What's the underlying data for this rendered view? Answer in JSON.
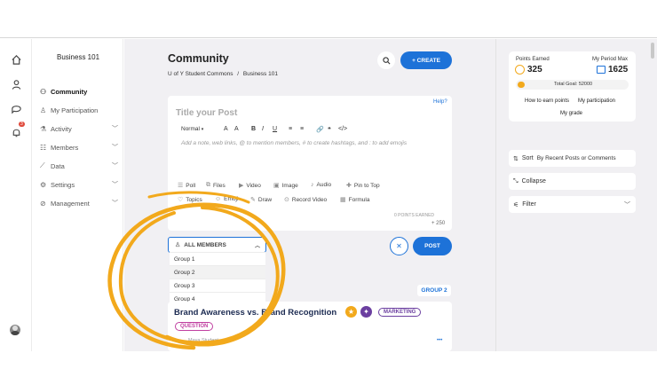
{
  "rail": {
    "icons": [
      "home-icon",
      "people-icon",
      "chat-icon",
      "bell-icon"
    ],
    "bell_count": "3"
  },
  "nav": {
    "title": "Business 101",
    "items": [
      {
        "label": "Community",
        "icon": "people-icon",
        "active": true,
        "chevron": false
      },
      {
        "label": "My Participation",
        "icon": "user-icon",
        "active": false,
        "chevron": false
      },
      {
        "label": "Activity",
        "icon": "activity-icon",
        "active": false,
        "chevron": true
      },
      {
        "label": "Members",
        "icon": "members-icon",
        "active": false,
        "chevron": true
      },
      {
        "label": "Data",
        "icon": "chart-icon",
        "active": false,
        "chevron": true
      },
      {
        "label": "Settings",
        "icon": "gear-icon",
        "active": false,
        "chevron": true
      },
      {
        "label": "Management",
        "icon": "compass-icon",
        "active": false,
        "chevron": true
      }
    ]
  },
  "header": {
    "title": "Community",
    "breadcrumb_1": "U of Y Student Commons",
    "breadcrumb_sep": "/",
    "breadcrumb_2": "Business 101",
    "create_label": "+ CREATE"
  },
  "composer": {
    "title_placeholder": "Title your Post",
    "help": "Help?",
    "format": "Normal",
    "toolbar": [
      "A",
      "A",
      "B",
      "I",
      "U",
      "≡",
      "≡",
      "🔗",
      "❝",
      "</>"
    ],
    "body_placeholder": "Add a note, web links, @ to mention members, # to create hashtags, and : to add emojis",
    "tools_row1": [
      "Poll",
      "Files",
      "Video",
      "Image",
      "Audio",
      "Pin to Top"
    ],
    "tools_row2": [
      "Topics",
      "Emoji",
      "Draw",
      "Record Video",
      "Formula"
    ],
    "points_earned": "0 POINTS EARNED",
    "points_plus": "+ 250"
  },
  "audience": {
    "selected": "ALL MEMBERS",
    "options": [
      "Group 1",
      "Group 2",
      "Group 3",
      "Group 4"
    ],
    "post_label": "POST",
    "cancel": "✕"
  },
  "post": {
    "group_tag": "GROUP 2",
    "title": "Brand Awareness vs. Brand Recognition",
    "category": "MARKETING",
    "type": "QUESTION",
    "author": "Maya Student",
    "more": "•••"
  },
  "points": {
    "earned_label": "Points Earned",
    "earned": "325",
    "max_label": "My Period Max",
    "max": "1625",
    "goal": "Total Goal: 52000",
    "progress": 0.06,
    "links": [
      "How to earn points",
      "My participation",
      "My grade"
    ]
  },
  "filters": {
    "sort_label": "Sort",
    "sort_value": "By Recent Posts or Comments",
    "collapse": "Collapse",
    "filter": "Filter"
  },
  "colors": {
    "accent": "#1d72d8",
    "highlight": "#f2a91c",
    "purple": "#6b3fa0"
  }
}
